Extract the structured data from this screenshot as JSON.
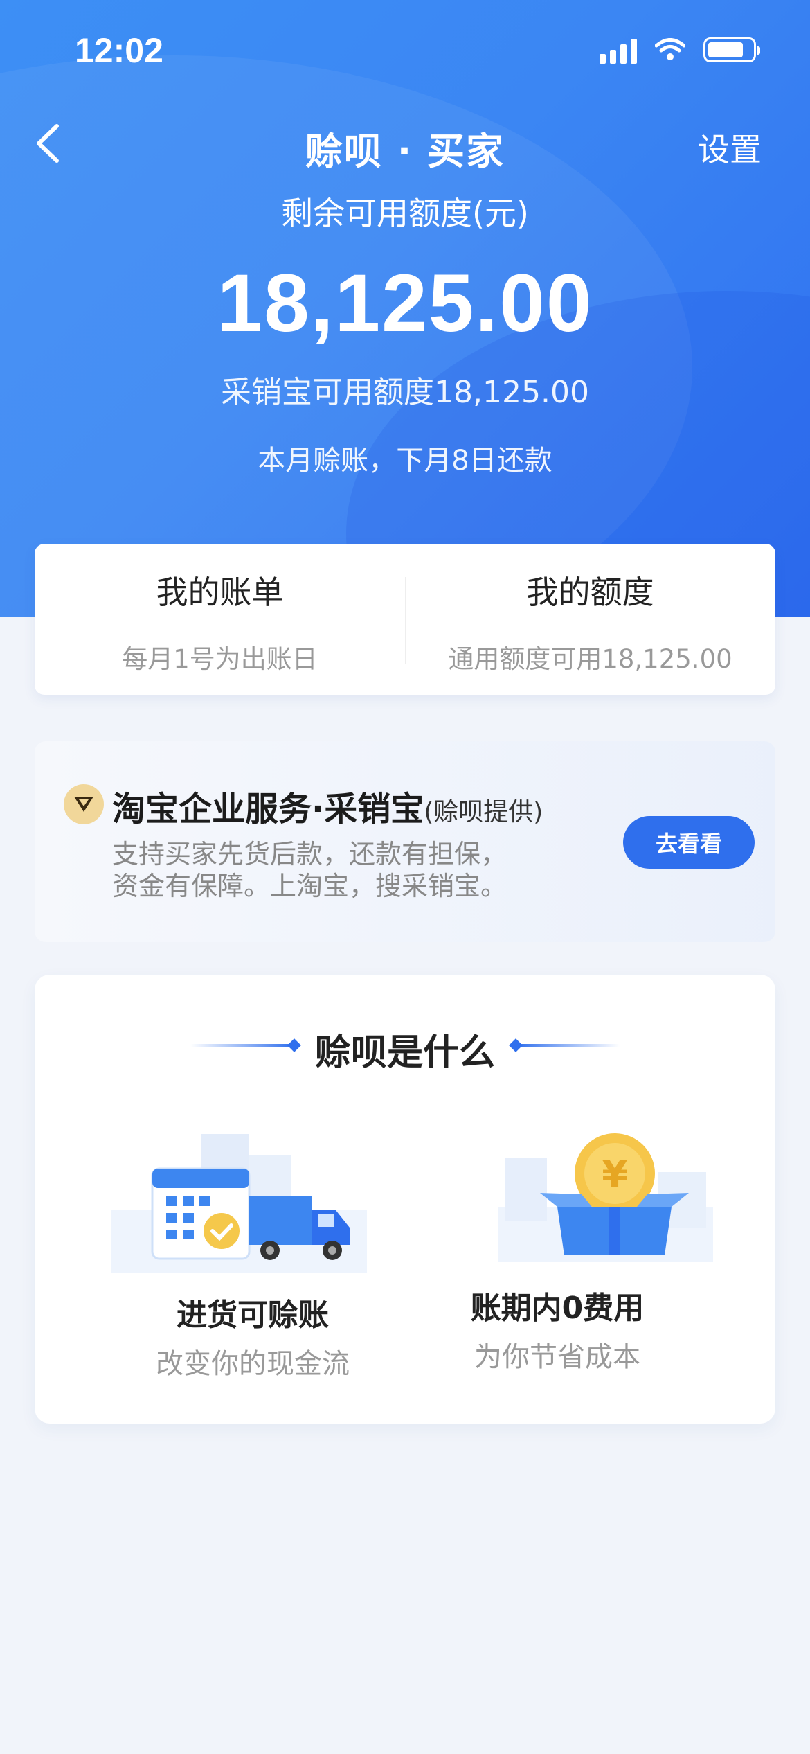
{
  "status_bar": {
    "time": "12:02"
  },
  "nav": {
    "title": "赊呗 · 买家",
    "settings_label": "设置"
  },
  "credit": {
    "label": "剩余可用额度(元)",
    "amount": "18,125.00",
    "sub": "采销宝可用额度18,125.00",
    "repay_note": "本月赊账，下月8日还款"
  },
  "summary": {
    "bill": {
      "title": "我的账单",
      "sub": "每月1号为出账日"
    },
    "quota": {
      "title": "我的额度",
      "sub": "通用额度可用18,125.00"
    }
  },
  "promo": {
    "title": "淘宝企业服务·采销宝",
    "title_suffix": "(赊呗提供)",
    "desc_line1": "支持买家先货后款，还款有担保，",
    "desc_line2": "资金有保障。上淘宝，搜采销宝。",
    "button_label": "去看看"
  },
  "what_is": {
    "title": "赊呗是什么",
    "features": [
      {
        "title": "进货可赊账",
        "sub": "改变你的现金流",
        "icon": "calendar-truck-icon"
      },
      {
        "title": "账期内0费用",
        "sub": "为你节省成本",
        "icon": "coin-box-icon"
      }
    ]
  },
  "colors": {
    "primary": "#2f6fed",
    "hero_start": "#3d8ff5",
    "background": "#f1f4fa"
  }
}
